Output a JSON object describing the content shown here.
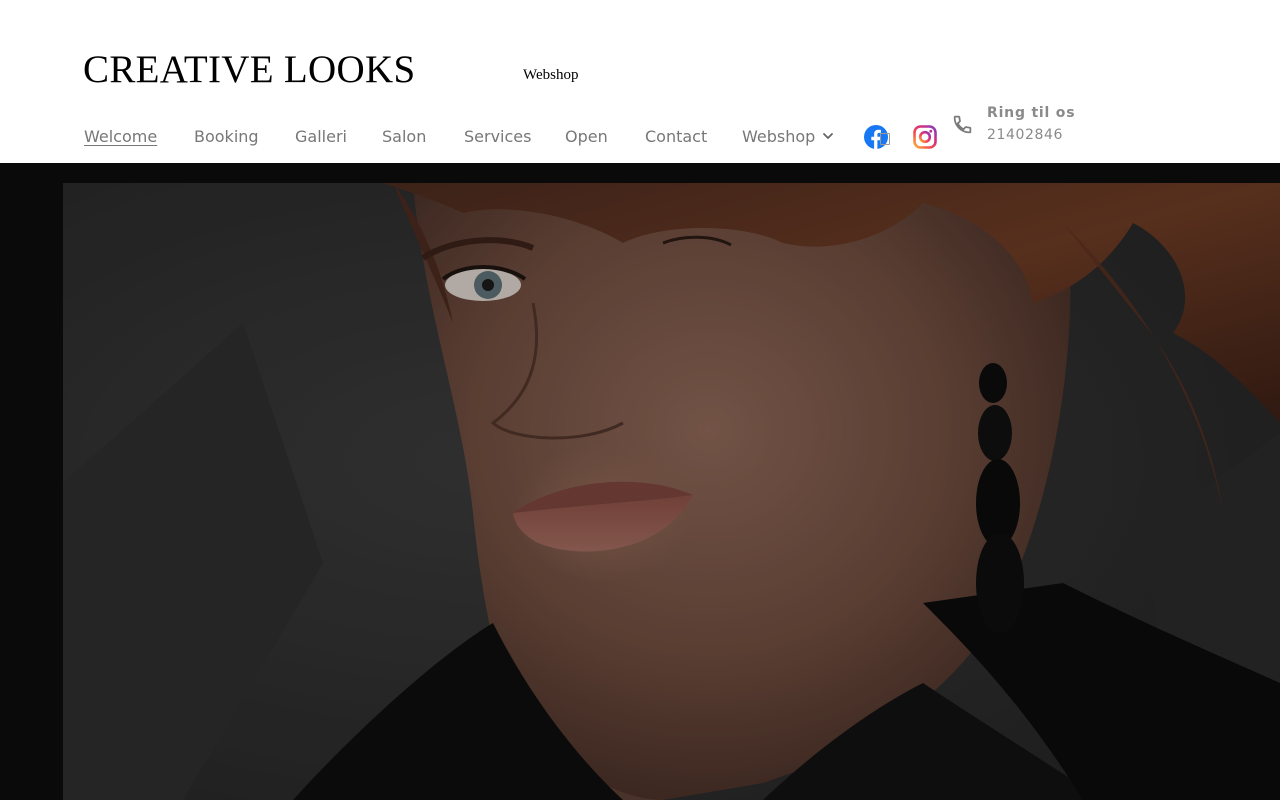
{
  "header": {
    "logo": "CREATIVE LOOKS",
    "top_link": "Webshop"
  },
  "nav": {
    "items": [
      {
        "label": "Welcome",
        "active": true
      },
      {
        "label": "Booking"
      },
      {
        "label": "Galleri"
      },
      {
        "label": "Salon"
      },
      {
        "label": "Services"
      },
      {
        "label": "Open"
      },
      {
        "label": "Contact"
      },
      {
        "label": "Webshop",
        "has_dropdown": true
      }
    ]
  },
  "social": {
    "facebook_icon": "facebook-icon",
    "instagram_icon": "instagram-icon"
  },
  "contact": {
    "icon": "phone-icon",
    "label": "Ring til os",
    "number": "21402846"
  },
  "colors": {
    "nav_text": "#777777",
    "facebook_blue": "#1877f2",
    "hero_background": "#0a0a0a"
  }
}
